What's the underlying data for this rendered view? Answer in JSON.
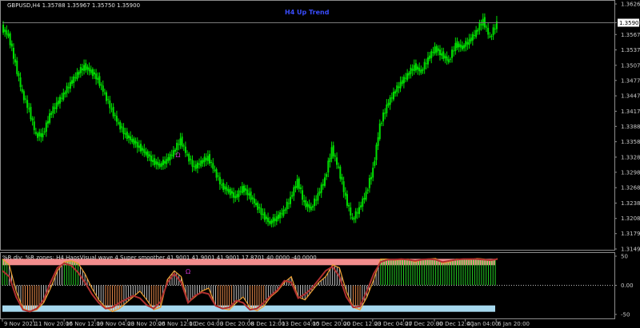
{
  "header": {
    "symbol_info": "GBPUSD,H4  1.35788 1.35967 1.35750 1.35900",
    "trend_label": "H4 Up Trend"
  },
  "indicator": {
    "label": "%R div: %R zones: H4 HaosVisual wave 4 Super smoother 41.9001 41.9001 41.9001 17.8701 40.0000 -40.0000",
    "marker": "Ω"
  },
  "colors": {
    "background": "#000000",
    "bull_candle": "#00e000",
    "frame": "#8c8c8c",
    "upper_zone": "#f28c8c",
    "lower_zone": "#a6d8ee",
    "oscillator_line": "#f0a030",
    "bull_histogram": "#22cc22",
    "bear_histogram": "#e88a4a",
    "wave_line": "#b03030",
    "marker": "#cc33cc",
    "trend_text": "#3a4dff"
  },
  "chart_data": [
    {
      "type": "line",
      "title": "",
      "series": [
        {
          "values": [
            1.358,
            1.3565,
            1.351,
            1.3452,
            1.342,
            1.337,
            1.3372,
            1.341,
            1.3432,
            1.345,
            1.3472,
            1.349,
            1.3505,
            1.3495,
            1.348,
            1.345,
            1.342,
            1.3392,
            1.3372,
            1.336,
            1.3348,
            1.3335,
            1.332,
            1.3312,
            1.3322,
            1.3338,
            1.3362,
            1.333,
            1.3308,
            1.3318,
            1.3328,
            1.33,
            1.3272,
            1.3262,
            1.325,
            1.3268,
            1.3255,
            1.3235,
            1.3215,
            1.32,
            1.321,
            1.3222,
            1.3248,
            1.3282,
            1.3238,
            1.3228,
            1.3255,
            1.3285,
            1.3345,
            1.3305,
            1.325,
            1.3205,
            1.3228,
            1.3258,
            1.3305,
            1.339,
            1.3428,
            1.3452,
            1.3472,
            1.3488,
            1.3505,
            1.3495,
            1.352,
            1.354,
            1.3528,
            1.3515,
            1.3548,
            1.3542,
            1.3555,
            1.3572,
            1.3595,
            1.356,
            1.359
          ]
        }
      ],
      "x_tick_labels": [
        "9 Nov 2021",
        "11 Nov 20:00",
        "16 Nov 12:00",
        "19 Nov 04:00",
        "23 Nov 20:00",
        "26 Nov 12:00",
        "1 Dec 04:00",
        "3 Dec 20:00",
        "8 Dec 12:00",
        "13 Dec 04:00",
        "15 Dec 20:00",
        "20 Dec 12:00",
        "23 Dec 04:00",
        "27 Dec 20:00",
        "30 Dec 12:00",
        "4 Jan 04:00",
        "6 Jan 20:00"
      ],
      "y_tick_labels": [
        "1.36265",
        "1.35900",
        "1.35670",
        "1.35370",
        "1.35070",
        "1.34775",
        "1.34475",
        "1.34175",
        "1.33880",
        "1.33580",
        "1.33280",
        "1.32985",
        "1.32685",
        "1.32385",
        "1.32085",
        "1.31790",
        "1.31490"
      ],
      "ylim": [
        1.3149,
        1.36265
      ],
      "current_price": 1.359,
      "grid": false
    },
    {
      "type": "area",
      "title": "",
      "y_tick_labels": [
        "50",
        "0.00",
        "-50"
      ],
      "ylim": [
        -50,
        50
      ],
      "levels": [
        40,
        -40
      ],
      "series": [
        {
          "values": [
            45,
            35,
            -10,
            -40,
            -45,
            -42,
            -30,
            -5,
            25,
            40,
            42,
            38,
            20,
            -5,
            -25,
            -38,
            -45,
            -40,
            -30,
            -20,
            -10,
            -25,
            -42,
            -38,
            10,
            25,
            15,
            -30,
            -20,
            -10,
            -5,
            -35,
            -40,
            -42,
            -30,
            -20,
            -38,
            -44,
            -36,
            -20,
            -10,
            5,
            15,
            -20,
            -25,
            -10,
            5,
            15,
            35,
            30,
            -10,
            -38,
            -42,
            -20,
            10,
            45,
            45,
            43,
            44,
            45,
            40,
            44,
            45,
            46,
            38,
            40,
            45,
            45,
            44,
            46,
            45,
            42,
            46
          ]
        },
        {
          "values": [
            25,
            15,
            -20,
            -42,
            -45,
            -40,
            -25,
            5,
            30,
            38,
            34,
            22,
            5,
            -15,
            -30,
            -40,
            -38,
            -30,
            -24,
            -18,
            -22,
            -34,
            -40,
            -28,
            5,
            20,
            5,
            -30,
            -18,
            -12,
            -15,
            -35,
            -40,
            -38,
            -26,
            -30,
            -42,
            -40,
            -30,
            -18,
            -8,
            8,
            5,
            -22,
            -15,
            -5,
            10,
            25,
            32,
            15,
            -20,
            -38,
            -36,
            -10,
            20,
            40,
            44,
            44,
            45,
            44,
            42,
            44,
            45,
            44,
            40,
            42,
            44,
            45,
            45,
            45,
            44,
            43,
            45
          ]
        }
      ]
    }
  ]
}
